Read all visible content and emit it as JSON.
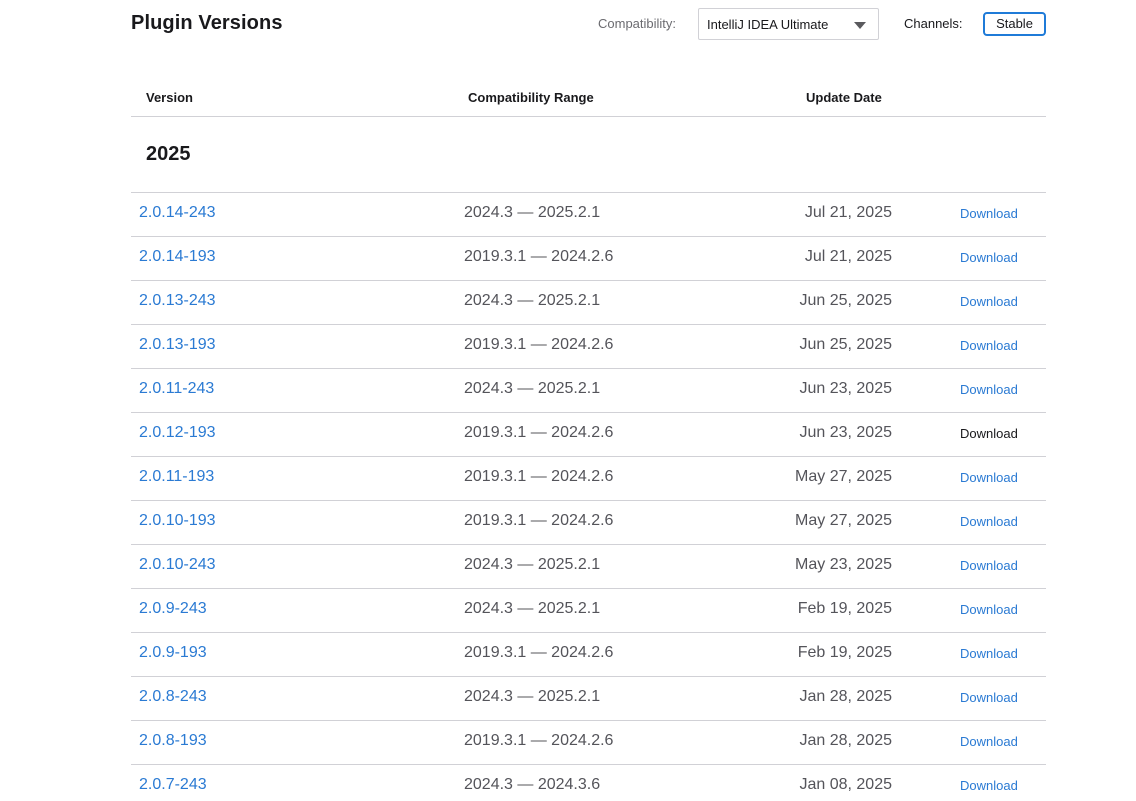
{
  "header": {
    "title": "Plugin Versions",
    "compatibility_label": "Compatibility:",
    "compatibility_value": "IntelliJ IDEA Ultimate",
    "channels_label": "Channels:",
    "channel_value": "Stable"
  },
  "table": {
    "columns": {
      "version": "Version",
      "compatibility": "Compatibility Range",
      "date": "Update Date"
    },
    "year": "2025",
    "rows": [
      {
        "version": "2.0.14-243",
        "range": "2024.3 — 2025.2.1",
        "date": "Jul 21, 2025",
        "download": "Download"
      },
      {
        "version": "2.0.14-193",
        "range": "2019.3.1 — 2024.2.6",
        "date": "Jul 21, 2025",
        "download": "Download"
      },
      {
        "version": "2.0.13-243",
        "range": "2024.3 — 2025.2.1",
        "date": "Jun 25, 2025",
        "download": "Download"
      },
      {
        "version": "2.0.13-193",
        "range": "2019.3.1 — 2024.2.6",
        "date": "Jun 25, 2025",
        "download": "Download"
      },
      {
        "version": "2.0.11-243",
        "range": "2024.3 — 2025.2.1",
        "date": "Jun 23, 2025",
        "download": "Download"
      },
      {
        "version": "2.0.12-193",
        "range": "2019.3.1 — 2024.2.6",
        "date": "Jun 23, 2025",
        "download": "Download",
        "hovered": true
      },
      {
        "version": "2.0.11-193",
        "range": "2019.3.1 — 2024.2.6",
        "date": "May 27, 2025",
        "download": "Download"
      },
      {
        "version": "2.0.10-193",
        "range": "2019.3.1 — 2024.2.6",
        "date": "May 27, 2025",
        "download": "Download"
      },
      {
        "version": "2.0.10-243",
        "range": "2024.3 — 2025.2.1",
        "date": "May 23, 2025",
        "download": "Download"
      },
      {
        "version": "2.0.9-243",
        "range": "2024.3 — 2025.2.1",
        "date": "Feb 19, 2025",
        "download": "Download"
      },
      {
        "version": "2.0.9-193",
        "range": "2019.3.1 — 2024.2.6",
        "date": "Feb 19, 2025",
        "download": "Download"
      },
      {
        "version": "2.0.8-243",
        "range": "2024.3 — 2025.2.1",
        "date": "Jan 28, 2025",
        "download": "Download"
      },
      {
        "version": "2.0.8-193",
        "range": "2019.3.1 — 2024.2.6",
        "date": "Jan 28, 2025",
        "download": "Download"
      },
      {
        "version": "2.0.7-243",
        "range": "2024.3 — 2024.3.6",
        "date": "Jan 08, 2025",
        "download": "Download"
      }
    ]
  },
  "colors": {
    "link": "#2a7ad3",
    "chip_border": "#1f7bd8",
    "divider": "#d1d1d6",
    "muted_text": "#54545a"
  }
}
